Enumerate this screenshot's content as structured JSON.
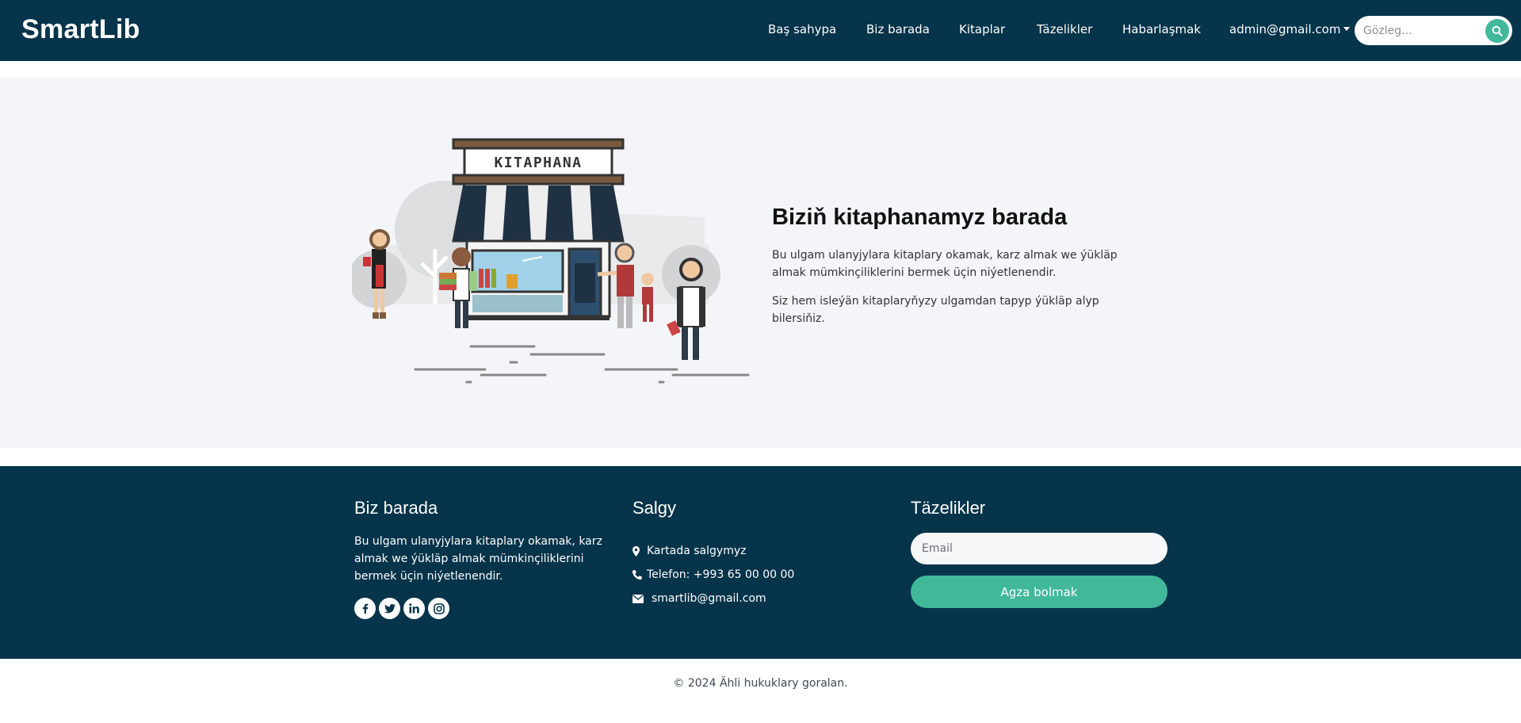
{
  "brand": "SmartLib",
  "nav": {
    "links": [
      "Baş sahypa",
      "Biz barada",
      "Kitaplar",
      "Täzelikler",
      "Habarlaşmak"
    ],
    "user": "admin@gmail.com",
    "search_placeholder": "Gözleg..."
  },
  "about": {
    "sign": "KITAPHANA",
    "title": "Biziň kitaphanamyz barada",
    "p1": "Bu ulgam ulanyjylara kitaplary okamak, karz almak we ýükläp almak mümkinçiliklerini bermek üçin niýetlenendir.",
    "p2": "Siz hem isleýän kitaplaryňyzy ulgamdan tapyp ýükläp alyp bilersiňiz."
  },
  "footer": {
    "about_title": "Biz barada",
    "about_text": "Bu ulgam ulanyjylara kitaplary okamak, karz almak we ýükläp almak mümkinçiliklerini bermek üçin niýetlenendir.",
    "social": [
      "facebook-icon",
      "twitter-icon",
      "linkedin-icon",
      "instagram-icon"
    ],
    "contact_title": "Salgy",
    "address": "Kartada salgymyz",
    "phone": "Telefon: +993 65 00 00 00",
    "email": "smartlib@gmail.com",
    "news_title": "Täzelikler",
    "email_placeholder": "Email",
    "subscribe": "Agza bolmak"
  },
  "copyright": "© 2024 Ähli hukuklary goralan.",
  "colors": {
    "navy": "#06344a",
    "accent": "#41b89a",
    "section_bg": "#f4f5f9"
  }
}
